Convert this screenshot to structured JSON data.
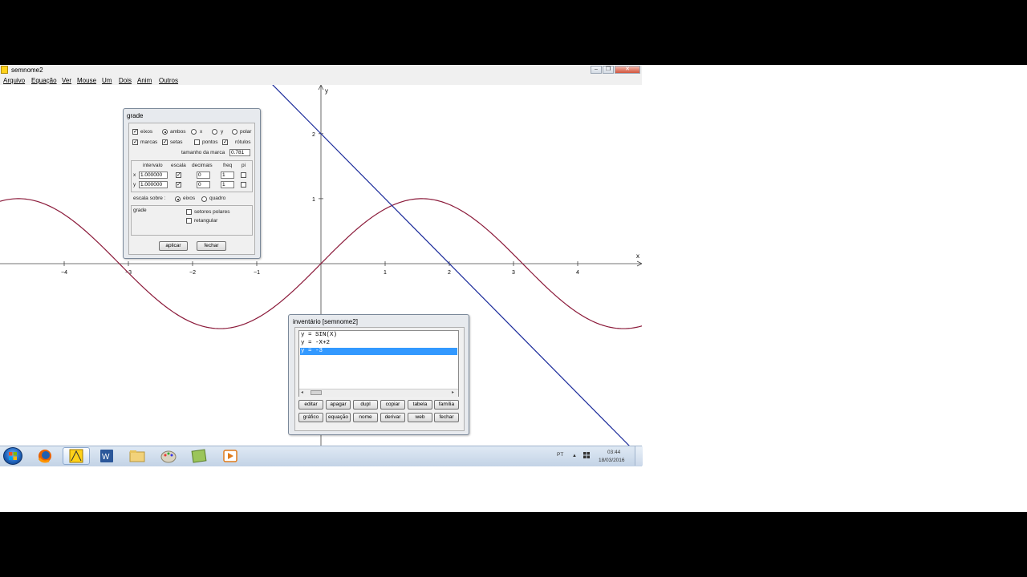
{
  "window": {
    "title": "semnome2"
  },
  "title_buttons": {
    "minimize": "–",
    "restore": "❐",
    "close": "✕"
  },
  "menu": [
    "Arquivo",
    "Equação",
    "Ver",
    "Mouse",
    "Um",
    "Dois",
    "Anim",
    "Outros"
  ],
  "plot": {
    "x_axis_label": "x",
    "y_axis_label": "y",
    "x_ticks": [
      "-4",
      "-3",
      "-2",
      "-1",
      "1",
      "2",
      "3",
      "4"
    ],
    "y_ticks": [
      "1",
      "2"
    ],
    "xlim": [
      -5,
      5
    ],
    "ylim": [
      -2.8,
      2.75
    ],
    "curves": [
      {
        "equation": "y = SIN(X)",
        "color": "#8b1a3a"
      },
      {
        "equation": "y = -X+2",
        "color": "#1a2a9a"
      }
    ]
  },
  "grade_dialog": {
    "title": "grade",
    "eixos": "eixos",
    "ambos": "ambos",
    "x_opt": "x",
    "y_opt": "y",
    "polar": "polar",
    "marcas": "marcas",
    "setas": "setas",
    "pontos": "pontos",
    "rotulos": "rótulos",
    "tamanho_label": "tamanho da marca",
    "tamanho_value": "0.781",
    "col_intervalo": "intervalo",
    "col_escala": "escala",
    "col_decimais": "decimais",
    "col_freq": "freq",
    "col_pi": "pi",
    "rows": [
      {
        "axis": "x",
        "intervalo": "1.000000",
        "decimais": "0",
        "freq": "1"
      },
      {
        "axis": "y",
        "intervalo": "1.000000",
        "decimais": "0",
        "freq": "1"
      }
    ],
    "escala_sobre": "escala sobre :",
    "escala_eixos": "eixos",
    "escala_quadro": "quadro",
    "group_label": "grade",
    "setores_polares": "setores polares",
    "retangular": "retangular",
    "aplicar": "aplicar",
    "fechar": "fechar"
  },
  "inventory": {
    "title": "inventário [semnome2]",
    "items": [
      "y = SIN(X)",
      "y = -X+2",
      "y = -3"
    ],
    "selected_index": 2,
    "buttons_row1": [
      "editar",
      "apagar",
      "dupl",
      "copiar",
      "tabela",
      "família"
    ],
    "buttons_row2": [
      "gráfico",
      "equação",
      "nome",
      "derivar",
      "web",
      "fechar"
    ]
  },
  "taskbar": {
    "lang": "PT",
    "time": "03:44",
    "date": "18/03/2016"
  }
}
